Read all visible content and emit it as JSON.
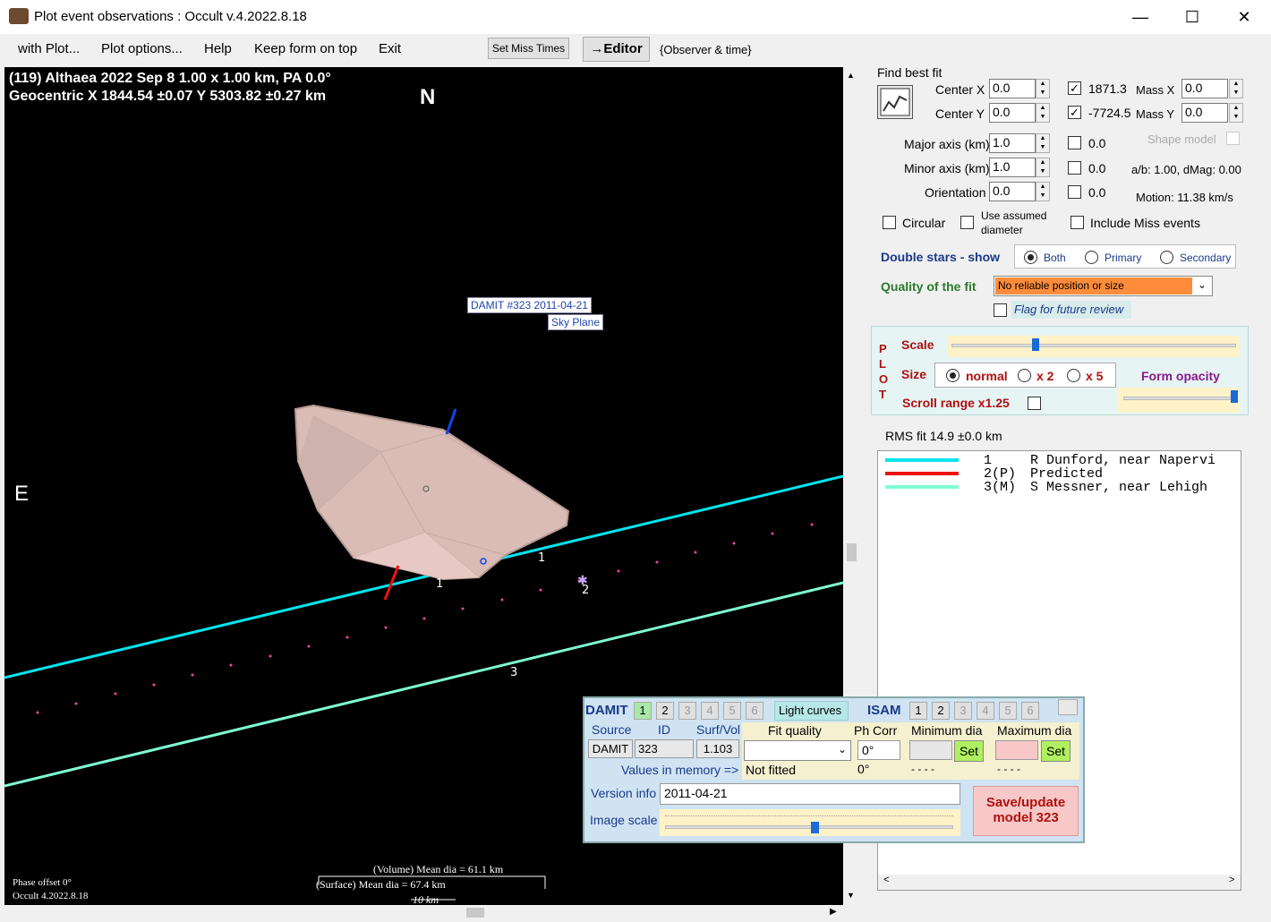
{
  "window": {
    "title": "Plot event observations : Occult v.4.2022.8.18",
    "minimize": "—",
    "maximize": "☐",
    "close": "✕"
  },
  "menu": {
    "with_plot": "with Plot...",
    "plot_options": "Plot options...",
    "help": "Help",
    "keep_on_top": "Keep form on top",
    "exit": "Exit",
    "set_miss_times": "Set Miss Times",
    "editor": "→Editor",
    "observer_time": "{Observer & time}"
  },
  "plot": {
    "header_line1": "(119) Althaea  2022 Sep 8   1.00 x 1.00 km, PA 0.0°",
    "header_line2": "Geocentric X  1844.54 ±0.07  Y 5303.82 ±0.27 km",
    "north": "N",
    "east": "E",
    "model_label_line1": "DAMIT #323 2011-04-21",
    "model_label_line2": "Sky Plane",
    "chord_labels": [
      "1",
      "1",
      "2",
      "3"
    ],
    "volume_dia": "(Volume) Mean dia = 61.1 km",
    "surface_dia": "(Surface) Mean dia = 67.4 km",
    "scale_bar": "10 km",
    "phase_offset": "Phase offset 0°",
    "version": "Occult 4.2022.8.18"
  },
  "fit": {
    "find_best_fit": "Find best fit",
    "center_x_label": "Center X",
    "center_x": "0.0",
    "center_y_label": "Center Y",
    "center_y": "0.0",
    "val_x": "1871.3",
    "val_y": "-7724.5",
    "mass_x_label": "Mass X",
    "mass_x": "0.0",
    "mass_y_label": "Mass Y",
    "mass_y": "0.0",
    "major_label": "Major axis (km)",
    "major": "1.0",
    "major_chk": "0.0",
    "minor_label": "Minor axis (km)",
    "minor": "1.0",
    "minor_chk": "0.0",
    "orient_label": "Orientation",
    "orient": "0.0",
    "orient_chk": "0.0",
    "shape_model": "Shape model",
    "ab_dmag": "a/b: 1.00, dMag: 0.00",
    "motion": "Motion: 11.38 km/s",
    "circular": "Circular",
    "use_assumed_1": "Use assumed",
    "use_assumed_2": "diameter",
    "include_miss": "Include Miss events",
    "double_stars": "Double stars - show",
    "both": "Both",
    "primary": "Primary",
    "secondary": "Secondary",
    "quality_label": "Quality of the fit",
    "quality_value": "No reliable position or size",
    "flag_future": "Flag for future review"
  },
  "plotsec": {
    "letters": [
      "P",
      "L",
      "O",
      "T"
    ],
    "scale": "Scale",
    "size": "Size",
    "normal": "normal",
    "x2": "x 2",
    "x5": "x 5",
    "form_opacity": "Form opacity",
    "scroll_range": "Scroll range x1.25"
  },
  "rms": "RMS fit 14.9 ±0.0 km",
  "legend": [
    {
      "num": "1",
      "tag": "",
      "name": "R Dunford, near Napervi",
      "color": "#00e5ee"
    },
    {
      "num": "2",
      "tag": "(P)",
      "name": "Predicted",
      "color": "#ee1111"
    },
    {
      "num": "3",
      "tag": "(M)",
      "name": "S Messner, near Lehigh",
      "color": "#7fffd4"
    }
  ],
  "damit": {
    "damit_label": "DAMIT",
    "nums": [
      "1",
      "2",
      "3",
      "4",
      "5",
      "6"
    ],
    "light_curves": "Light curves",
    "isam_label": "ISAM",
    "source_h": "Source",
    "id_h": "ID",
    "surf_h": "Surf/Vol",
    "source": "DAMIT",
    "id": "323",
    "surf": "1.103",
    "values_mem": "Values in memory =>",
    "fit_quality_h": "Fit quality",
    "ph_corr_h": "Ph Corr",
    "min_dia_h": "Minimum dia",
    "max_dia_h": "Maximum dia",
    "not_fitted": "Not fitted",
    "ph_corr_val": "0°",
    "ph_corr_mem": "0°",
    "set": "Set",
    "dashes": "- - - -",
    "version_info_label": "Version info",
    "version_info": "2011-04-21",
    "image_scale": "Image scale",
    "save_update_1": "Save/update",
    "save_update_2": "model 323"
  }
}
